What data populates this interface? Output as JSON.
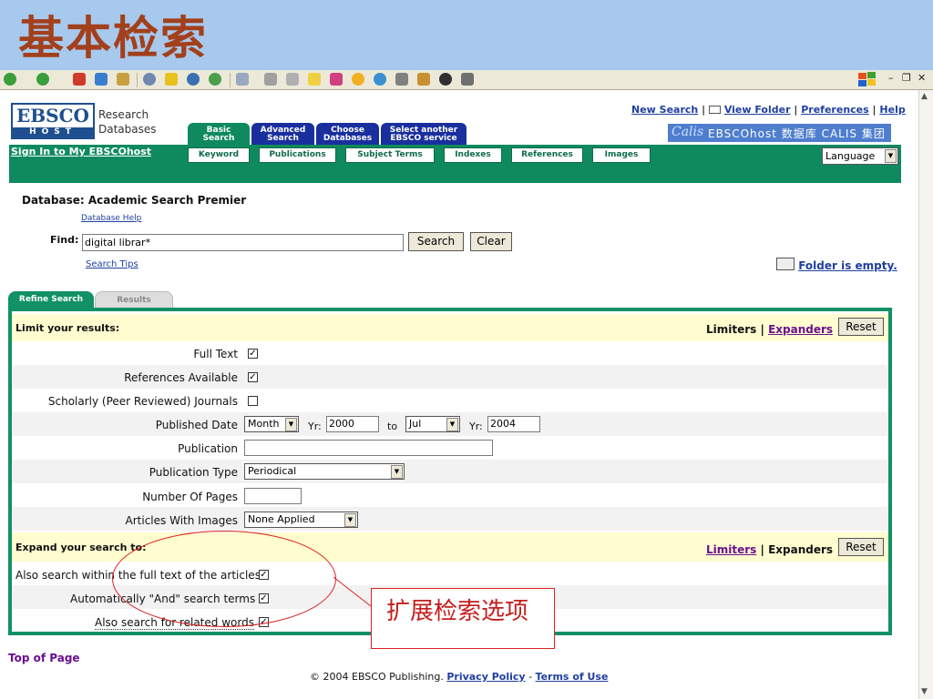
{
  "slide": {
    "title": "基本检索",
    "title_color": "#a3401c",
    "band_color": "#a7c9ee"
  },
  "ebsco": {
    "logo_top": "EBSCO",
    "logo_bottom": "HOST",
    "product_line1": "Research",
    "product_line2": "Databases",
    "top_links": {
      "new_search": "New Search",
      "view_folder": "View Folder",
      "preferences": "Preferences",
      "help": "Help",
      "sep": "|"
    },
    "calis_banner": "EBSCOhost 数据库 CALIS 集团",
    "calis_logo": "Calis",
    "main_tabs": [
      {
        "line1": "Basic",
        "line2": "Search"
      },
      {
        "line1": "Advanced",
        "line2": "Search"
      },
      {
        "line1": "Choose",
        "line2": "Databases"
      },
      {
        "line1": "Select another",
        "line2": "EBSCO service"
      }
    ],
    "sign_in": "Sign In to My EBSCOhost",
    "sub_tabs": [
      "Keyword",
      "Publications",
      "Subject Terms",
      "Indexes",
      "References",
      "Images"
    ],
    "language": "Language",
    "database_label": "Database: Academic Search Premier",
    "database_help": "Database Help",
    "find_label": "Find:",
    "find_value": "digital librar*",
    "search_button": "Search",
    "clear_button": "Clear",
    "search_tips": "Search Tips",
    "folder_status": "Folder is empty.",
    "brand_green": "#0f8a5f"
  },
  "refine": {
    "tab_refine": "Refine Search",
    "tab_results": "Results",
    "limit_header": "Limit your results:",
    "limiters": "Limiters",
    "expanders": "Expanders",
    "reset": "Reset",
    "fields": {
      "full_text": {
        "label": "Full Text",
        "checked": true
      },
      "references": {
        "label": "References Available",
        "checked": true
      },
      "scholarly": {
        "label": "Scholarly (Peer Reviewed) Journals",
        "checked": false
      },
      "published_date": {
        "label": "Published Date",
        "from_month": "Month",
        "yr_label": "Yr:",
        "from_year": "2000",
        "to_label": "to",
        "to_month": "Jul",
        "to_year": "2004"
      },
      "publication": {
        "label": "Publication",
        "value": ""
      },
      "publication_type": {
        "label": "Publication Type",
        "value": "Periodical"
      },
      "number_of_pages": {
        "label": "Number Of Pages",
        "value": ""
      },
      "articles_with_images": {
        "label": "Articles With Images",
        "value": "None Applied"
      }
    },
    "expand_header": "Expand your search to:",
    "expand_options": [
      {
        "label": "Also search within the full text of the articles",
        "checked": true
      },
      {
        "label": "Automatically \"And\" search terms",
        "checked": true
      },
      {
        "label": "Also search for related words",
        "checked": true
      }
    ]
  },
  "footer": {
    "top_of_page": "Top of Page",
    "copyright": "© 2004 EBSCO Publishing.",
    "privacy": "Privacy Policy",
    "dash": "-",
    "terms": "Terms of Use"
  },
  "annotation": {
    "callout_text": "扩展检索选项",
    "color": "#c41e1e"
  }
}
